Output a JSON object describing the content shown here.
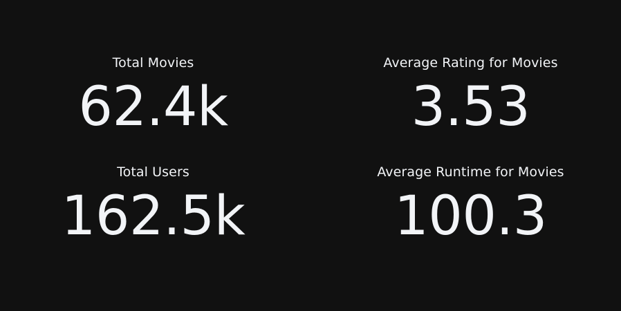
{
  "chart_data": {
    "type": "table",
    "indicators": [
      {
        "title": "Total Movies",
        "value": 62400,
        "display": "62.4k"
      },
      {
        "title": "Average Rating for Movies",
        "value": 3.53,
        "display": "3.53"
      },
      {
        "title": "Total Users",
        "value": 162500,
        "display": "162.5k"
      },
      {
        "title": "Average Runtime for Movies",
        "value": 100.3,
        "display": "100.3"
      }
    ]
  },
  "colors": {
    "background": "#111111",
    "text": "#f2f4f7"
  }
}
